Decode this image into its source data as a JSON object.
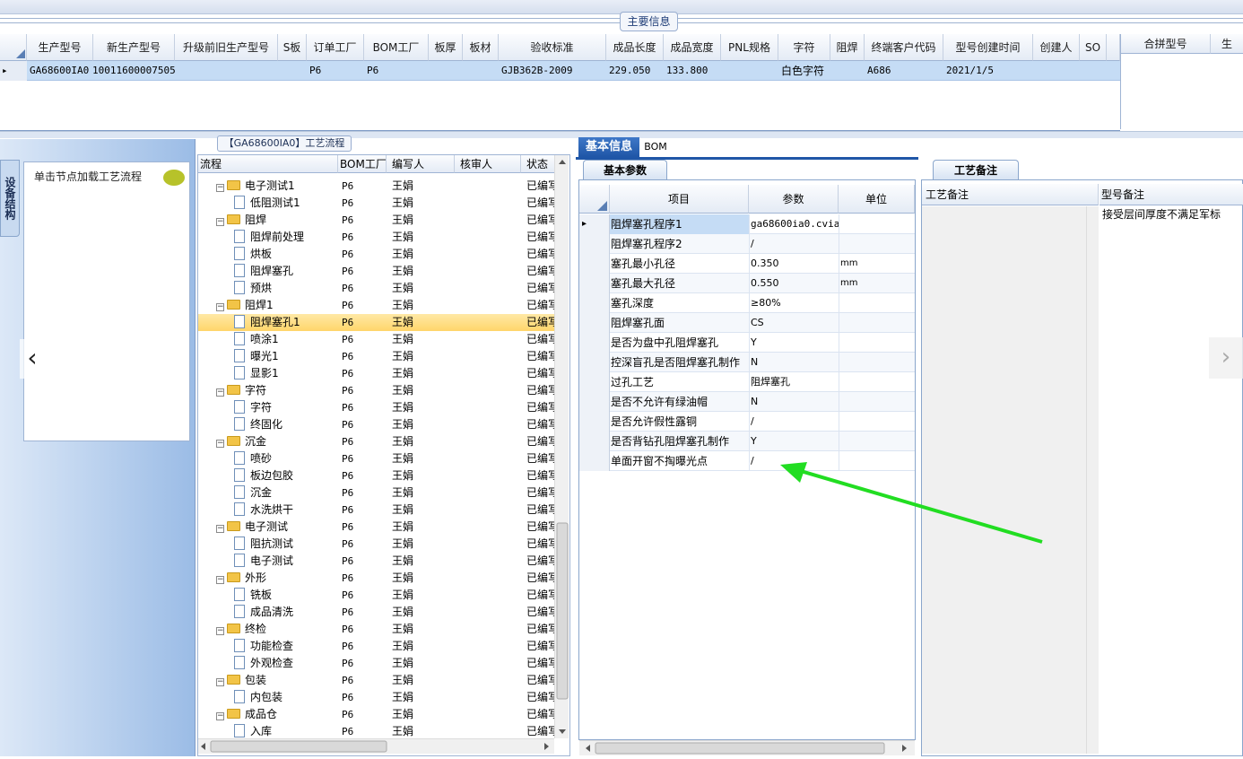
{
  "header": {
    "main_info_label": "主要信息"
  },
  "top_table": {
    "columns": [
      "生产型号",
      "新生产型号",
      "升级前旧生产型号",
      "S板",
      "订单工厂",
      "BOM工厂",
      "板厚",
      "板材",
      "验收标准",
      "成品长度",
      "成品宽度",
      "PNL规格",
      "字符",
      "阻焊",
      "终端客户代码",
      "型号创建时间",
      "创建人",
      "SO"
    ],
    "row": {
      "prod_model": "GA68600IA0",
      "new_model": "10011600007505",
      "order_factory": "P6",
      "bom_factory": "P6",
      "acceptance": "GJB362B-2009",
      "length": "229.050",
      "width": "133.800",
      "char": "白色字符",
      "customer_code": "A686",
      "create_time": "2021/1/5"
    },
    "right_columns": [
      "合拼型号",
      "生"
    ]
  },
  "left_panel": {
    "vertical_tab": "设备结构",
    "hint": "单击节点加载工艺流程"
  },
  "tree": {
    "title": "【GA68600IA0】工艺流程",
    "columns": [
      "流程",
      "BOM工厂",
      "编写人",
      "核审人",
      "状态"
    ],
    "rows": [
      {
        "type": "folder",
        "label": "电子测试1",
        "factory": "P6",
        "author": "王娟",
        "status": "已编写"
      },
      {
        "type": "doc",
        "label": "低阻测试1",
        "factory": "P6",
        "author": "王娟",
        "status": "已编写"
      },
      {
        "type": "folder",
        "label": "阻焊",
        "factory": "P6",
        "author": "王娟",
        "status": "已编写"
      },
      {
        "type": "doc",
        "label": "阻焊前处理",
        "factory": "P6",
        "author": "王娟",
        "status": "已编写"
      },
      {
        "type": "doc",
        "label": "烘板",
        "factory": "P6",
        "author": "王娟",
        "status": "已编写"
      },
      {
        "type": "doc",
        "label": "阻焊塞孔",
        "factory": "P6",
        "author": "王娟",
        "status": "已编写"
      },
      {
        "type": "doc",
        "label": "预烘",
        "factory": "P6",
        "author": "王娟",
        "status": "已编写"
      },
      {
        "type": "folder",
        "label": "阻焊1",
        "factory": "P6",
        "author": "王娟",
        "status": "已编写"
      },
      {
        "type": "doc",
        "label": "阻焊塞孔1",
        "factory": "P6",
        "author": "王娟",
        "status": "已编写",
        "selected": true
      },
      {
        "type": "doc",
        "label": "喷涂1",
        "factory": "P6",
        "author": "王娟",
        "status": "已编写"
      },
      {
        "type": "doc",
        "label": "曝光1",
        "factory": "P6",
        "author": "王娟",
        "status": "已编写"
      },
      {
        "type": "doc",
        "label": "显影1",
        "factory": "P6",
        "author": "王娟",
        "status": "已编写"
      },
      {
        "type": "folder",
        "label": "字符",
        "factory": "P6",
        "author": "王娟",
        "status": "已编写"
      },
      {
        "type": "doc",
        "label": "字符",
        "factory": "P6",
        "author": "王娟",
        "status": "已编写"
      },
      {
        "type": "doc",
        "label": "终固化",
        "factory": "P6",
        "author": "王娟",
        "status": "已编写"
      },
      {
        "type": "folder",
        "label": "沉金",
        "factory": "P6",
        "author": "王娟",
        "status": "已编写"
      },
      {
        "type": "doc",
        "label": "喷砂",
        "factory": "P6",
        "author": "王娟",
        "status": "已编写"
      },
      {
        "type": "doc",
        "label": "板边包胶",
        "factory": "P6",
        "author": "王娟",
        "status": "已编写"
      },
      {
        "type": "doc",
        "label": "沉金",
        "factory": "P6",
        "author": "王娟",
        "status": "已编写"
      },
      {
        "type": "doc",
        "label": "水洗烘干",
        "factory": "P6",
        "author": "王娟",
        "status": "已编写"
      },
      {
        "type": "folder",
        "label": "电子测试",
        "factory": "P6",
        "author": "王娟",
        "status": "已编写"
      },
      {
        "type": "doc",
        "label": "阻抗测试",
        "factory": "P6",
        "author": "王娟",
        "status": "已编写"
      },
      {
        "type": "doc",
        "label": "电子测试",
        "factory": "P6",
        "author": "王娟",
        "status": "已编写"
      },
      {
        "type": "folder",
        "label": "外形",
        "factory": "P6",
        "author": "王娟",
        "status": "已编写"
      },
      {
        "type": "doc",
        "label": "铣板",
        "factory": "P6",
        "author": "王娟",
        "status": "已编写"
      },
      {
        "type": "doc",
        "label": "成品清洗",
        "factory": "P6",
        "author": "王娟",
        "status": "已编写"
      },
      {
        "type": "folder",
        "label": "终检",
        "factory": "P6",
        "author": "王娟",
        "status": "已编写"
      },
      {
        "type": "doc",
        "label": "功能检查",
        "factory": "P6",
        "author": "王娟",
        "status": "已编写"
      },
      {
        "type": "doc",
        "label": "外观检查",
        "factory": "P6",
        "author": "王娟",
        "status": "已编写"
      },
      {
        "type": "folder",
        "label": "包装",
        "factory": "P6",
        "author": "王娟",
        "status": "已编写"
      },
      {
        "type": "doc",
        "label": "内包装",
        "factory": "P6",
        "author": "王娟",
        "status": "已编写"
      },
      {
        "type": "folder",
        "label": "成品仓",
        "factory": "P6",
        "author": "王娟",
        "status": "已编写"
      },
      {
        "type": "doc",
        "label": "入库",
        "factory": "P6",
        "author": "王娟",
        "status": "已编写"
      }
    ]
  },
  "info_tabs": {
    "basic": "基本信息",
    "bom": "BOM"
  },
  "params": {
    "tab_label": "基本参数",
    "columns": [
      "项目",
      "参数",
      "单位"
    ],
    "rows": [
      {
        "item": "阻焊塞孔程序1",
        "value": "ga68600ia0.cvia",
        "unit": "",
        "current": true
      },
      {
        "item": "阻焊塞孔程序2",
        "value": "/",
        "unit": ""
      },
      {
        "item": "塞孔最小孔径",
        "value": "0.350",
        "unit": "mm"
      },
      {
        "item": "塞孔最大孔径",
        "value": "0.550",
        "unit": "mm"
      },
      {
        "item": "塞孔深度",
        "value": "≥80%",
        "unit": ""
      },
      {
        "item": "阻焊塞孔面",
        "value": "CS",
        "unit": ""
      },
      {
        "item": "是否为盘中孔阻焊塞孔",
        "value": "Y",
        "unit": ""
      },
      {
        "item": "控深盲孔是否阻焊塞孔制作",
        "value": "N",
        "unit": ""
      },
      {
        "item": "过孔工艺",
        "value": "阻焊塞孔",
        "unit": ""
      },
      {
        "item": "是否不允许有绿油帽",
        "value": "N",
        "unit": ""
      },
      {
        "item": "是否允许假性露铜",
        "value": "/",
        "unit": ""
      },
      {
        "item": "是否背钻孔阻焊塞孔制作",
        "value": "Y",
        "unit": ""
      },
      {
        "item": "单面开窗不掏曝光点",
        "value": "/",
        "unit": ""
      }
    ]
  },
  "remarks": {
    "tab_label": "工艺备注",
    "col1": "工艺备注",
    "col2": "型号备注",
    "model_remark": "接受层间厚度不满足军标"
  },
  "colors": {
    "arrow": "#22dd22",
    "accent": "#1f56a7",
    "selected_row": "#c5dcf5"
  }
}
